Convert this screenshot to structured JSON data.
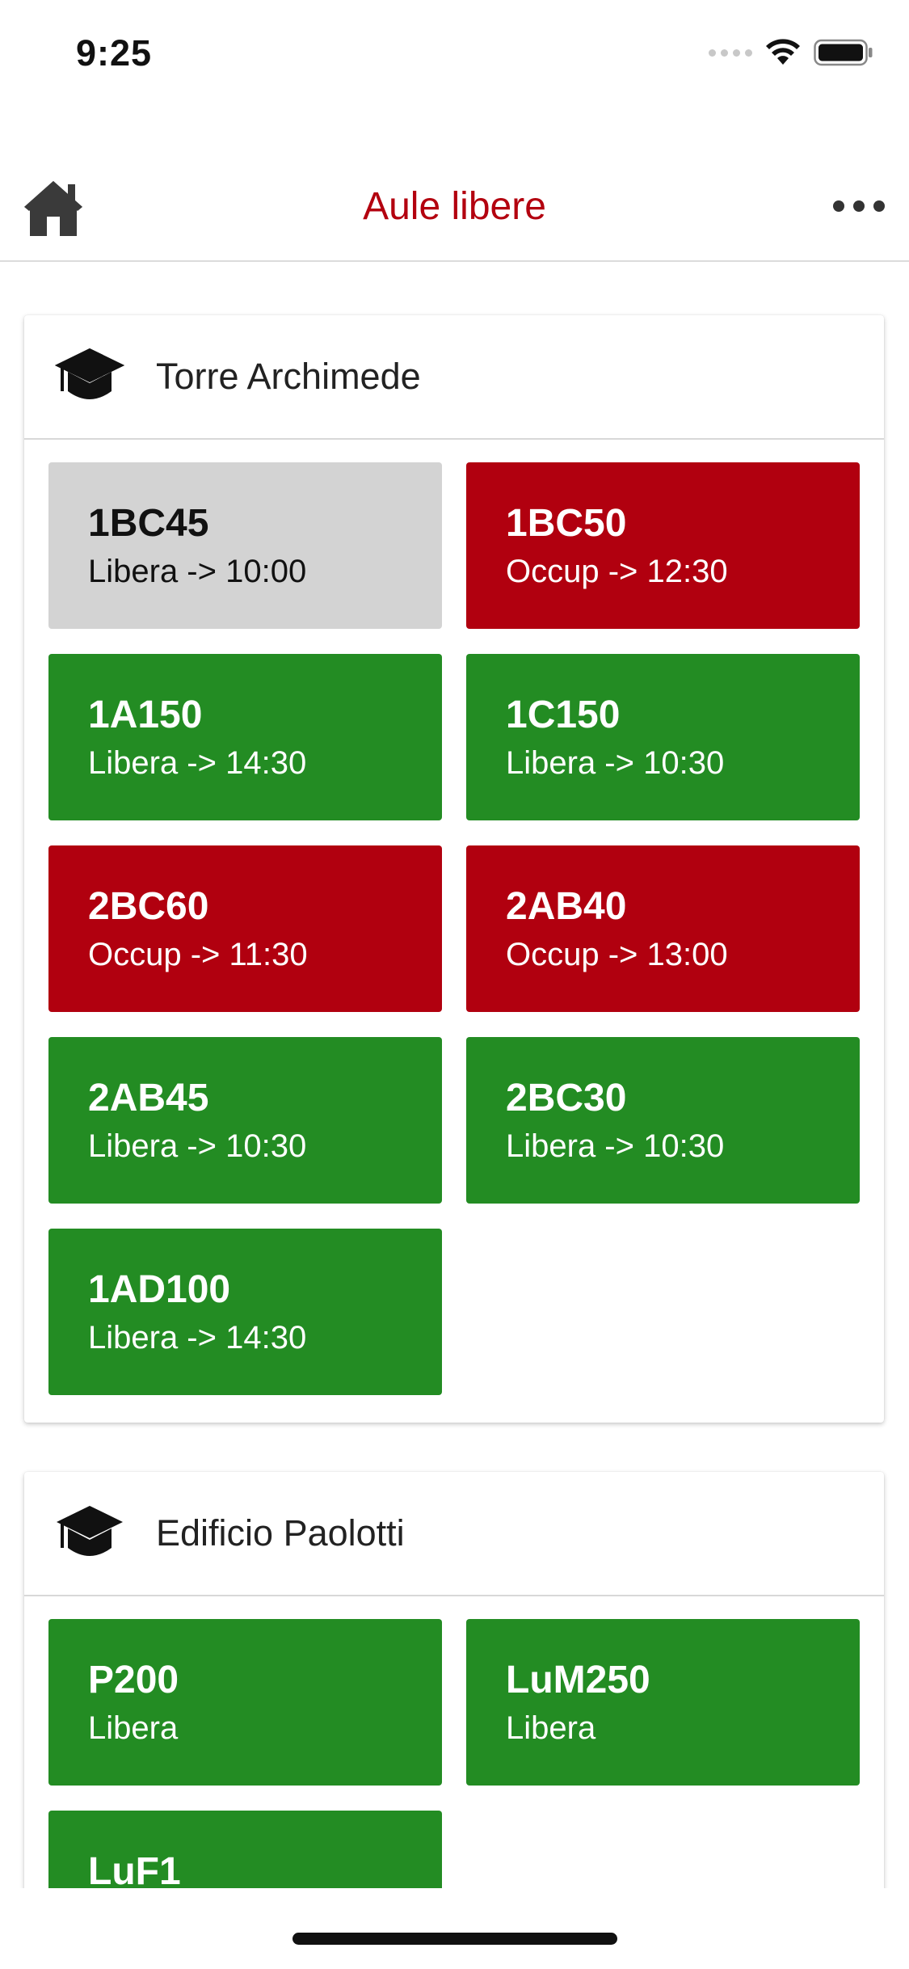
{
  "status_bar": {
    "time": "9:25",
    "icons": [
      "signal-dots-icon",
      "wifi-icon",
      "battery-icon"
    ]
  },
  "nav": {
    "title": "Aule libere",
    "home_icon": "home-icon",
    "more_icon": "more-icon"
  },
  "colors": {
    "accent": "#b3000f",
    "free": "#238c23",
    "occupied": "#b1000f",
    "neutral": "#d3d3d3"
  },
  "buildings": [
    {
      "name": "Torre Archimede",
      "icon": "graduation-cap-icon",
      "rooms": [
        {
          "room": "1BC45",
          "state": "Libera -> 10:00",
          "status": "grey"
        },
        {
          "room": "1BC50",
          "state": "Occup -> 12:30",
          "status": "red"
        },
        {
          "room": "1A150",
          "state": "Libera -> 14:30",
          "status": "green"
        },
        {
          "room": "1C150",
          "state": "Libera -> 10:30",
          "status": "green"
        },
        {
          "room": "2BC60",
          "state": "Occup -> 11:30",
          "status": "red"
        },
        {
          "room": "2AB40",
          "state": "Occup -> 13:00",
          "status": "red"
        },
        {
          "room": "2AB45",
          "state": "Libera -> 10:30",
          "status": "green"
        },
        {
          "room": "2BC30",
          "state": "Libera -> 10:30",
          "status": "green"
        },
        {
          "room": "1AD100",
          "state": "Libera -> 14:30",
          "status": "green"
        }
      ]
    },
    {
      "name": "Edificio Paolotti",
      "icon": "graduation-cap-icon",
      "rooms": [
        {
          "room": "P200",
          "state": "Libera",
          "status": "green"
        },
        {
          "room": "LuM250",
          "state": "Libera",
          "status": "green"
        },
        {
          "room": "LuF1",
          "state": "",
          "status": "green"
        }
      ]
    }
  ]
}
